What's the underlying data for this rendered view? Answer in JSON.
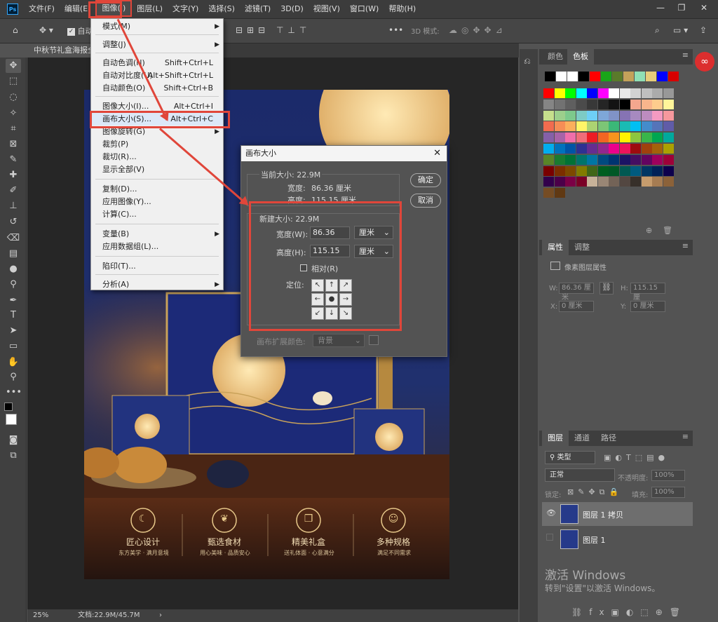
{
  "menubar": {
    "items": [
      "文件(F)",
      "编辑(E)",
      "图像(I)",
      "图层(L)",
      "文字(Y)",
      "选择(S)",
      "滤镜(T)",
      "3D(D)",
      "视图(V)",
      "窗口(W)",
      "帮助(H)"
    ],
    "active_index": 2
  },
  "options": {
    "auto_label": "自动",
    "mode3d": "3D 模式:"
  },
  "document": {
    "tab": "中秋节礼盒海报全",
    "zoom": "25%",
    "doc_size": "文档:22.9M/45.7M"
  },
  "image_menu": {
    "items": [
      {
        "label": "模式(M)",
        "shortcut": "",
        "submenu": true,
        "enabled": true
      },
      {
        "label": "调整(J)",
        "shortcut": "",
        "submenu": true,
        "enabled": true
      },
      {
        "label": "自动色调(N)",
        "shortcut": "Shift+Ctrl+L",
        "submenu": false,
        "enabled": true
      },
      {
        "label": "自动对比度(U)",
        "shortcut": "Alt+Shift+Ctrl+L",
        "submenu": false,
        "enabled": true
      },
      {
        "label": "自动颜色(O)",
        "shortcut": "Shift+Ctrl+B",
        "submenu": false,
        "enabled": true
      },
      {
        "label": "图像大小(I)...",
        "shortcut": "Alt+Ctrl+I",
        "submenu": false,
        "enabled": true
      },
      {
        "label": "画布大小(S)...",
        "shortcut": "Alt+Ctrl+C",
        "submenu": false,
        "enabled": true,
        "highlighted": true
      },
      {
        "label": "图像旋转(G)",
        "shortcut": "",
        "submenu": true,
        "enabled": true
      },
      {
        "label": "裁剪(P)",
        "shortcut": "",
        "submenu": false,
        "enabled": true
      },
      {
        "label": "裁切(R)...",
        "shortcut": "",
        "submenu": false,
        "enabled": true
      },
      {
        "label": "显示全部(V)",
        "shortcut": "",
        "submenu": false,
        "enabled": true
      },
      {
        "label": "复制(D)...",
        "shortcut": "",
        "submenu": false,
        "enabled": true
      },
      {
        "label": "应用图像(Y)...",
        "shortcut": "",
        "submenu": false,
        "enabled": true
      },
      {
        "label": "计算(C)...",
        "shortcut": "",
        "submenu": false,
        "enabled": true
      },
      {
        "label": "变量(B)",
        "shortcut": "",
        "submenu": true,
        "enabled": true
      },
      {
        "label": "应用数据组(L)...",
        "shortcut": "",
        "submenu": false,
        "enabled": true
      },
      {
        "label": "陷印(T)...",
        "shortcut": "",
        "submenu": false,
        "enabled": true
      },
      {
        "label": "分析(A)",
        "shortcut": "",
        "submenu": true,
        "enabled": true
      }
    ]
  },
  "canvas_dialog": {
    "title": "画布大小",
    "current_size": "当前大小: 22.9M",
    "current_width_label": "宽度:",
    "current_width": "86.36 厘米",
    "current_height_label": "高度:",
    "current_height": "115.15 厘米",
    "new_size": "新建大小: 22.9M",
    "width_label": "宽度(W):",
    "width_value": "86.36",
    "height_label": "高度(H):",
    "height_value": "115.15",
    "unit": "厘米",
    "relative_label": "相对(R)",
    "anchor_label": "定位:",
    "ext_color_label": "画布扩展颜色:",
    "ext_color_value": "背景",
    "ok": "确定",
    "cancel": "取消"
  },
  "poster": {
    "features": [
      {
        "title": "匠心设计",
        "sub": "东方美学 · 满月意境"
      },
      {
        "title": "甄选食材",
        "sub": "用心美味 · 品质安心"
      },
      {
        "title": "精美礼盒",
        "sub": "送礼体面 · 心意满分"
      },
      {
        "title": "多种规格",
        "sub": "满足不同需求"
      }
    ]
  },
  "color_panel": {
    "tabs": [
      "颜色",
      "色板"
    ],
    "active": 1
  },
  "props_panel": {
    "tabs": [
      "属性",
      "调整"
    ],
    "title": "像素图层属性",
    "w_label": "W:",
    "w": "86.36 厘米",
    "h_label": "H:",
    "h": "115.15 厘",
    "x_label": "X:",
    "x": "0 厘米",
    "y_label": "Y:",
    "y": "0 厘米"
  },
  "layers_panel": {
    "tabs": [
      "图层",
      "通道",
      "路径"
    ],
    "filter": "类型",
    "blend": "正常",
    "opacity_label": "不透明度:",
    "opacity": "100%",
    "lock_label": "锁定:",
    "fill_label": "填充:",
    "fill": "100%",
    "layers": [
      {
        "name": "图层 1 拷贝",
        "visible": true,
        "selected": true
      },
      {
        "name": "图层 1",
        "visible": false,
        "selected": false
      }
    ]
  },
  "watermark": {
    "line1": "激活 Windows",
    "line2": "转到\"设置\"以激活 Windows。"
  }
}
